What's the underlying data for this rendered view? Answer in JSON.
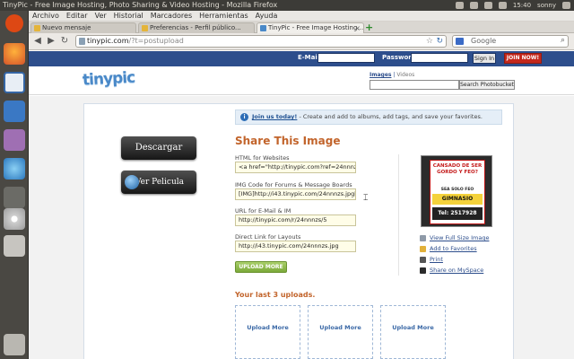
{
  "window": {
    "title": "TinyPic - Free Image Hosting, Photo Sharing & Video Hosting - Mozilla Firefox",
    "tray_time": "15:40",
    "tray_user": "sonny"
  },
  "menubar": [
    "Archivo",
    "Editar",
    "Ver",
    "Historial",
    "Marcadores",
    "Herramientas",
    "Ayuda"
  ],
  "tabs": [
    {
      "label": "Nuevo mensaje",
      "active": false
    },
    {
      "label": "Preferencias - Perfil público...",
      "active": false
    },
    {
      "label": "TinyPic - Free Image Hosting...",
      "active": true
    }
  ],
  "navbar": {
    "url_domain": "tinypic.com",
    "url_path": "/?t=postupload",
    "search_placeholder": "Google"
  },
  "tinypic": {
    "email_label": "E-Mail:",
    "password_label": "Password:",
    "signin_label": "Sign In",
    "join_label": "JOIN NOW!",
    "logo_text": "tinypic",
    "search_tab_images": "Images",
    "search_tab_sep": " | ",
    "search_tab_videos": "Videos",
    "search_button": "Search Photobucket"
  },
  "content": {
    "descargar_label": "Descargar",
    "ver_label": "Ver Pelicula",
    "notice_link": "Join us today!",
    "notice_text": " - Create and add to albums, add tags, and save your favorites.",
    "share_title": "Share This Image",
    "fields": [
      {
        "label": "HTML for Websites",
        "value": "<a href=\"http://tinypic.com?ref=24nnnzs\""
      },
      {
        "label": "IMG Code for Forums & Message Boards",
        "value": "[IMG]http://i43.tinypic.com/24nnnzs.jpg[/IMG]"
      },
      {
        "label": "URL for E-Mail & IM",
        "value": "http://tinypic.com/r/24nnnzs/5"
      },
      {
        "label": "Direct Link for Layouts",
        "value": "http://i43.tinypic.com/24nnnzs.jpg"
      }
    ],
    "upload_more_button": "UPLOAD MORE",
    "thumbnail": {
      "line1": "CANSADO DE SER GORDO Y FEO?",
      "line2": "SEA SOLO FEO",
      "line3": "GIMNASIO",
      "line4": "Tel: 2517928"
    },
    "actions": [
      "View Full Size Image",
      "Add to Favorites",
      "Print",
      "Share on MySpace"
    ],
    "last_uploads_title": "Your last 3 uploads.",
    "upload_slots": [
      "Upload More",
      "Upload More",
      "Upload More"
    ]
  },
  "colors": {
    "tinypic_blue": "#2d4e8c",
    "share_orange": "#c2642b",
    "join_red": "#c4281c",
    "upload_green": "#7ba93a"
  }
}
